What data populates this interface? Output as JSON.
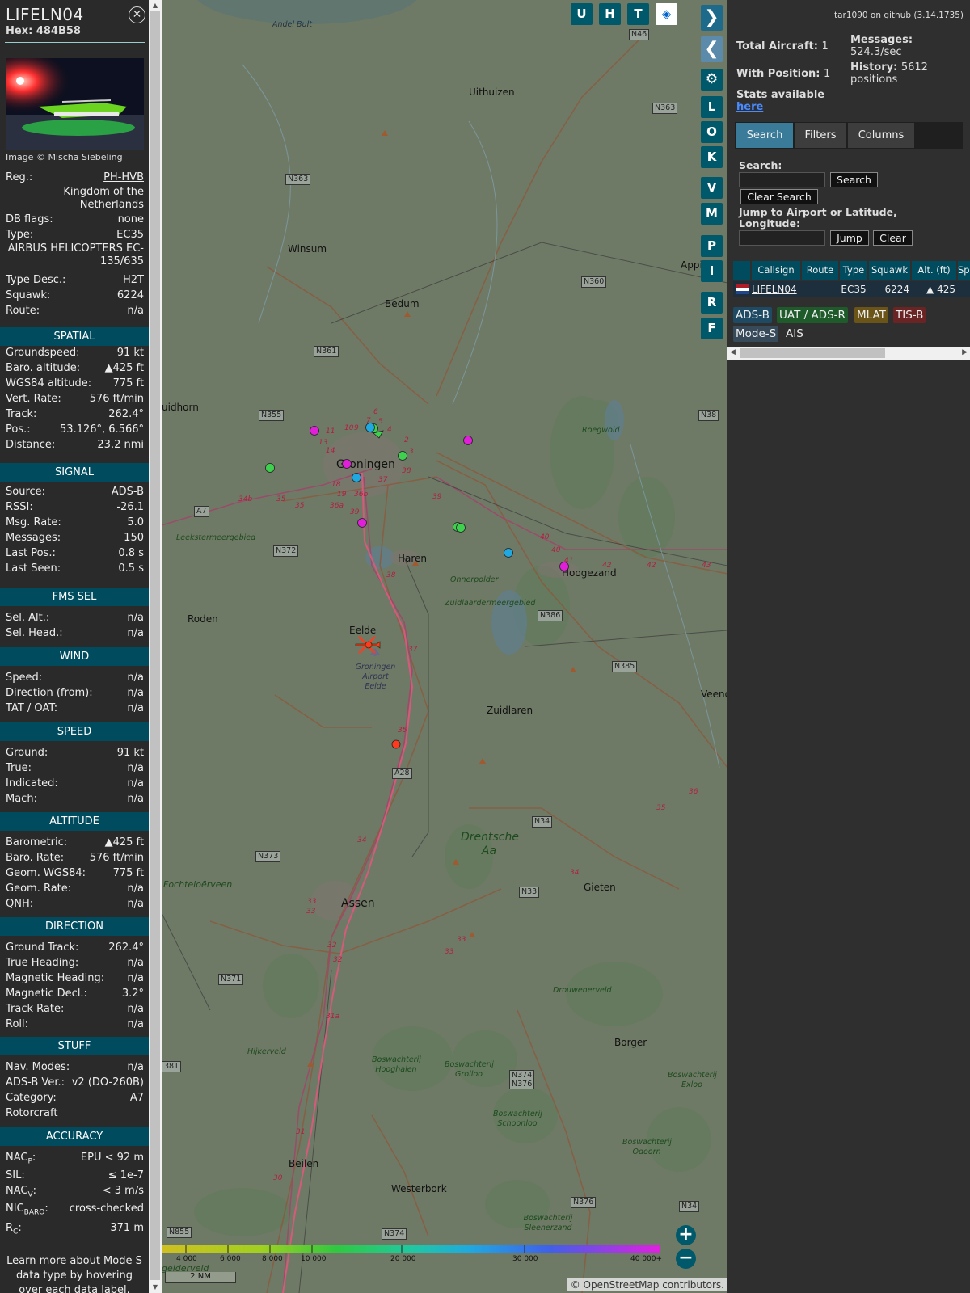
{
  "aircraft": {
    "callsign": "LIFELN04",
    "hex_label": "Hex:",
    "hex": "484B58",
    "image_credit": "Image © Mischa Siebeling",
    "reg_label": "Reg.:",
    "reg": "PH-HVB",
    "country": "Kingdom of the Netherlands",
    "db_flags_label": "DB flags:",
    "db_flags": "none",
    "type_label": "Type:",
    "type": "EC35",
    "model": "AIRBUS HELICOPTERS EC-135/635",
    "type_desc_label": "Type Desc.:",
    "type_desc": "H2T",
    "squawk_label": "Squawk:",
    "squawk": "6224",
    "route_label": "Route:",
    "route": "n/a"
  },
  "sections": {
    "spatial": "SPATIAL",
    "signal": "SIGNAL",
    "fms": "FMS SEL",
    "wind": "WIND",
    "speed": "SPEED",
    "altitude": "ALTITUDE",
    "direction": "DIRECTION",
    "stuff": "STUFF",
    "accuracy": "ACCURACY"
  },
  "spatial": [
    [
      "Groundspeed:",
      "91 kt"
    ],
    [
      "Baro. altitude:",
      "▲425 ft"
    ],
    [
      "WGS84 altitude:",
      "775 ft"
    ],
    [
      "Vert. Rate:",
      "576 ft/min"
    ],
    [
      "Track:",
      "262.4°"
    ],
    [
      "Pos.:",
      "53.126°, 6.566°"
    ],
    [
      "Distance:",
      "23.2 nmi"
    ]
  ],
  "signal": [
    [
      "Source:",
      "ADS-B"
    ],
    [
      "RSSI:",
      "-26.1"
    ],
    [
      "Msg. Rate:",
      "5.0"
    ],
    [
      "Messages:",
      "150"
    ],
    [
      "Last Pos.:",
      "0.8 s"
    ],
    [
      "Last Seen:",
      "0.5 s"
    ]
  ],
  "fms": [
    [
      "Sel. Alt.:",
      "n/a"
    ],
    [
      "Sel. Head.:",
      "n/a"
    ]
  ],
  "wind": [
    [
      "Speed:",
      "n/a"
    ],
    [
      "Direction (from):",
      "n/a"
    ],
    [
      "TAT / OAT:",
      "n/a"
    ]
  ],
  "speed": [
    [
      "Ground:",
      "91 kt"
    ],
    [
      "True:",
      "n/a"
    ],
    [
      "Indicated:",
      "n/a"
    ],
    [
      "Mach:",
      "n/a"
    ]
  ],
  "altitude": [
    [
      "Barometric:",
      "▲425 ft"
    ],
    [
      "Baro. Rate:",
      "576 ft/min"
    ],
    [
      "Geom. WGS84:",
      "775 ft"
    ],
    [
      "Geom. Rate:",
      "n/a"
    ],
    [
      "QNH:",
      "n/a"
    ]
  ],
  "direction": [
    [
      "Ground Track:",
      "262.4°"
    ],
    [
      "True Heading:",
      "n/a"
    ],
    [
      "Magnetic Heading:",
      "n/a"
    ],
    [
      "Magnetic Decl.:",
      "3.2°"
    ],
    [
      "Track Rate:",
      "n/a"
    ],
    [
      "Roll:",
      "n/a"
    ]
  ],
  "stuff": [
    [
      "Nav. Modes:",
      "n/a"
    ],
    [
      "ADS-B Ver.:",
      "v2 (DO-260B)"
    ],
    [
      "Category:",
      "A7"
    ],
    [
      "Rotorcraft",
      ""
    ]
  ],
  "accuracy": {
    "nacp_k": "NAC",
    "nacp_sub": "P",
    "nacp_v": "EPU < 92 m",
    "sil_k": "SIL:",
    "sil_v": "≤ 1e-7",
    "nacv_k": "NAC",
    "nacv_sub": "V",
    "nacv_v": "< 3 m/s",
    "nic_k": "NIC",
    "nic_sub": "BARO",
    "nic_v": "cross-checked",
    "rc_k": "R",
    "rc_sub": "C",
    "rc_v": "371 m"
  },
  "learn_more": "Learn more about Mode S data type by hovering over each data label.",
  "map": {
    "top_buttons": [
      "U",
      "H",
      "T"
    ],
    "side_buttons": [
      "L",
      "O",
      "K",
      "V",
      "M",
      "P",
      "I",
      "R",
      "F"
    ],
    "places": {
      "andel_bult": "Andel Bult",
      "uithuizen": "Uithuizen",
      "winsum": "Winsum",
      "bedum": "Bedum",
      "appingedam": "Appin",
      "uidhorn": "uidhorn",
      "groningen": "Groningen",
      "roegwold": "Roegwold",
      "leekstermeer": "Leekstermeergebied",
      "haren": "Haren",
      "hoogezand": "Hoogezand",
      "onnerpolder": "Onnerpolder",
      "zuidlaarder": "Zuidlaardermeergebied",
      "roden": "Roden",
      "eelde": "Eelde",
      "airport": "Groningen Airport Eelde",
      "veend": "Veend",
      "zuidlaren": "Zuidlaren",
      "drentsche": "Drentsche Aa",
      "fochtel": "Fochteloërveen",
      "assen": "Assen",
      "gieten": "Gieten",
      "drouwen": "Drouwenerveld",
      "borger": "Borger",
      "hijkerveld": "Hijkerveld",
      "hooghalen": "Boswachterij Hooghalen",
      "grolloo": "Boswachterij Grolloo",
      "schoonloo": "Boswachterij Schoonloo",
      "exloo": "Boswachterij Exloo",
      "odoorn": "Boswachterij Odoorn",
      "beilen": "Beilen",
      "westerbork": "Westerbork",
      "sleenerzand": "Boswachterij Sleenerzand",
      "gelderveld": "gelderveld"
    },
    "roads": {
      "n46": "N46",
      "n363a": "N363",
      "n363b": "N363",
      "n360": "N360",
      "n361": "N361",
      "n355": "N355",
      "n38": "N38",
      "a7": "A7",
      "n372": "N372",
      "n386": "N386",
      "n385": "N385",
      "a28": "A28",
      "n34": "N34",
      "n373": "N373",
      "n33": "N33",
      "n371": "N371",
      "n381": "381",
      "n374a": "N374",
      "n376a": "N376",
      "n376b": "N376",
      "n34b": "N34",
      "n855": "N855",
      "n374b": "N374"
    },
    "altitude_ticks": [
      "4 000",
      "6 000",
      "8 000",
      "10 000",
      "20 000",
      "30 000",
      "40 000+"
    ],
    "scale_label": "2 NM",
    "attribution": "© OpenStreetMap contributors.",
    "colors": {
      "selected_aircraft": "#ff3a1f",
      "adsb_magenta": "#e020d8",
      "low_green": "#40d050"
    }
  },
  "panel": {
    "github": "tar1090 on github (3.14.1735)",
    "total_label": "Total Aircraft:",
    "total": "1",
    "messages_label": "Messages:",
    "messages": "524.3/sec",
    "withpos_label": "With Position:",
    "withpos": "1",
    "history_label": "History:",
    "history": "5612 positions",
    "stats_label": "Stats available",
    "stats_link": "here",
    "tabs": [
      "Search",
      "Filters",
      "Columns"
    ],
    "search_label": "Search:",
    "search_btn": "Search",
    "clear_search_btn": "Clear Search",
    "jump_label": "Jump to Airport or Latitude, Longitude:",
    "jump_btn": "Jump",
    "clear_btn": "Clear",
    "columns": [
      "Callsign",
      "Route",
      "Type",
      "Squawk",
      "Alt. (ft)",
      "Sp"
    ],
    "row": {
      "callsign": "LIFELN04",
      "type": "EC35",
      "squawk": "6224",
      "alt": "▲ 425"
    },
    "badges": [
      "ADS-B",
      "UAT / ADS-R",
      "MLAT",
      "TIS-B",
      "Mode-S",
      "AIS"
    ],
    "badge_colors": {
      "adsb": "#1e4a64",
      "uat": "#1e5a2a",
      "mlat": "#6a5418",
      "tisb": "#6a2424",
      "modes": "#364a5a"
    }
  }
}
